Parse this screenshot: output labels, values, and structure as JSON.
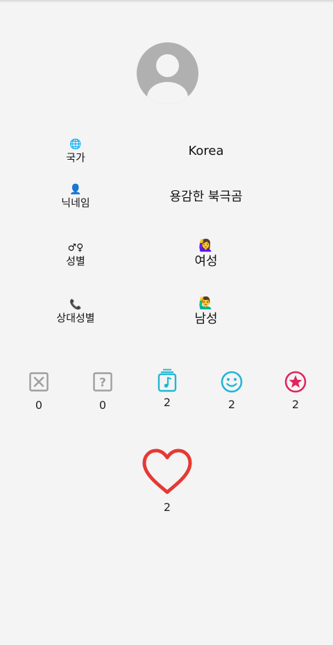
{
  "profile": {
    "rows": [
      {
        "label": "국가",
        "label_icon": "🌐",
        "value": "Korea"
      },
      {
        "label": "닉네임",
        "label_icon": "👤",
        "value": "용감한 북극곰"
      },
      {
        "label": "성별",
        "label_icon": "♂♀",
        "value": "여성",
        "value_icon": "🙋‍♀️"
      },
      {
        "label": "상대성별",
        "label_icon": "📞",
        "value": "남성",
        "value_icon": "🙋‍♂️"
      }
    ]
  },
  "stats": [
    {
      "icon": "close-box-icon",
      "count": "0",
      "color": "#9e9e9e"
    },
    {
      "icon": "question-box-icon",
      "count": "0",
      "color": "#9e9e9e"
    },
    {
      "icon": "music-note-stack-icon",
      "count": "2",
      "color": "#1fb6d6"
    },
    {
      "icon": "smiley-icon",
      "count": "2",
      "color": "#1fb6d6"
    },
    {
      "icon": "star-circle-icon",
      "count": "2",
      "color": "#e0245e"
    }
  ],
  "like": {
    "icon": "heart-outline-icon",
    "count": "2",
    "color": "#e53935"
  }
}
